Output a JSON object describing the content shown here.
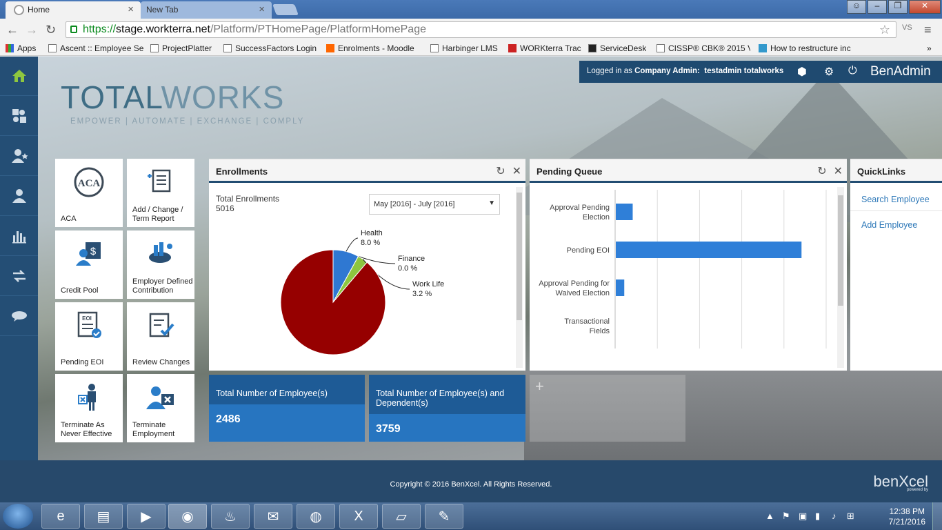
{
  "browser": {
    "tabs": [
      {
        "label": "Home",
        "active": true
      },
      {
        "label": "New Tab",
        "active": false
      }
    ],
    "url": {
      "scheme": "https://",
      "host": "stage.workterra.net",
      "path": "/Platform/PTHomePage/PlatformHomePage"
    },
    "extension_label": "VS",
    "bookmarks": [
      "Apps",
      "Ascent :: Employee Se",
      "ProjectPlatter",
      "SuccessFactors Login",
      "Enrolments - Moodle",
      "Harbinger LMS",
      "WORKterra Trac",
      "ServiceDesk",
      "CISSP® CBK® 2015 V",
      "How to restructure inc"
    ]
  },
  "header": {
    "logo_word_a": "TOTAL",
    "logo_word_b": "WORKS",
    "logo_tagline": "EMPOWER  |  AUTOMATE  |  EXCHANGE  |  COMPLY",
    "login_prefix": "Logged in as",
    "login_role": "Company Admin:",
    "login_user": "testadmin totalworks",
    "app_name": "BenAdmin"
  },
  "sidebar": {
    "items": [
      "home-icon",
      "puzzle-icon",
      "user-star-icon",
      "user-icon",
      "bar-chart-icon",
      "transfer-icon",
      "chat-icon"
    ]
  },
  "tiles": [
    {
      "label": "ACA",
      "icon": "aca-icon"
    },
    {
      "label": "Add / Change / Term Report",
      "icon": "report-icon"
    },
    {
      "label": "Credit Pool",
      "icon": "credit-pool-icon"
    },
    {
      "label": "Employer Defined Contribution",
      "icon": "contribution-icon"
    },
    {
      "label": "Pending EOI",
      "icon": "eoi-icon"
    },
    {
      "label": "Review Changes",
      "icon": "review-icon"
    },
    {
      "label": "Terminate As Never Effective",
      "icon": "terminate-never-icon"
    },
    {
      "label": "Terminate Employment",
      "icon": "terminate-icon"
    }
  ],
  "enrollments": {
    "title": "Enrollments",
    "total_label": "Total Enrollments",
    "total_value": "5016",
    "period": "May [2016] - July [2016]"
  },
  "chart_data": [
    {
      "type": "pie",
      "slices": [
        {
          "name": "Health",
          "value": 8.0,
          "label": "8.0 %",
          "color": "#2f78d2"
        },
        {
          "name": "Finance",
          "value": 0.0,
          "label": "0.0 %",
          "color": "#f0a030"
        },
        {
          "name": "Work Life",
          "value": 3.2,
          "label": "3.2 %",
          "color": "#8dc63f"
        },
        {
          "name": "",
          "value": 88.8,
          "label": "",
          "color": "#960000"
        }
      ]
    },
    {
      "type": "bar",
      "orientation": "horizontal",
      "categories": [
        "Approval Pending Election",
        "Pending EOI",
        "Approval Pending for Waived Election",
        "Transactional Fields"
      ],
      "values": [
        4,
        44,
        2,
        0
      ],
      "xlim": [
        0,
        50
      ],
      "grid": true,
      "color": "#2f7fd8"
    }
  ],
  "pending_queue": {
    "title": "Pending Queue"
  },
  "quicklinks": {
    "title": "QuickLinks",
    "links": [
      "Search Employee",
      "Add Employee"
    ]
  },
  "stats": [
    {
      "label": "Total Number of Employee(s)",
      "value": "2486"
    },
    {
      "label": "Total Number of Employee(s) and Dependent(s)",
      "value": "3759"
    }
  ],
  "add_widget_symbol": "+",
  "footer": {
    "copyright": "Copyright © 2016 BenXcel. All Rights Reserved.",
    "brand_a": "ben",
    "brand_b": "Xcel",
    "brand_sub": "powered by"
  },
  "taskbar": {
    "time": "12:38 PM",
    "date": "7/21/2016"
  }
}
